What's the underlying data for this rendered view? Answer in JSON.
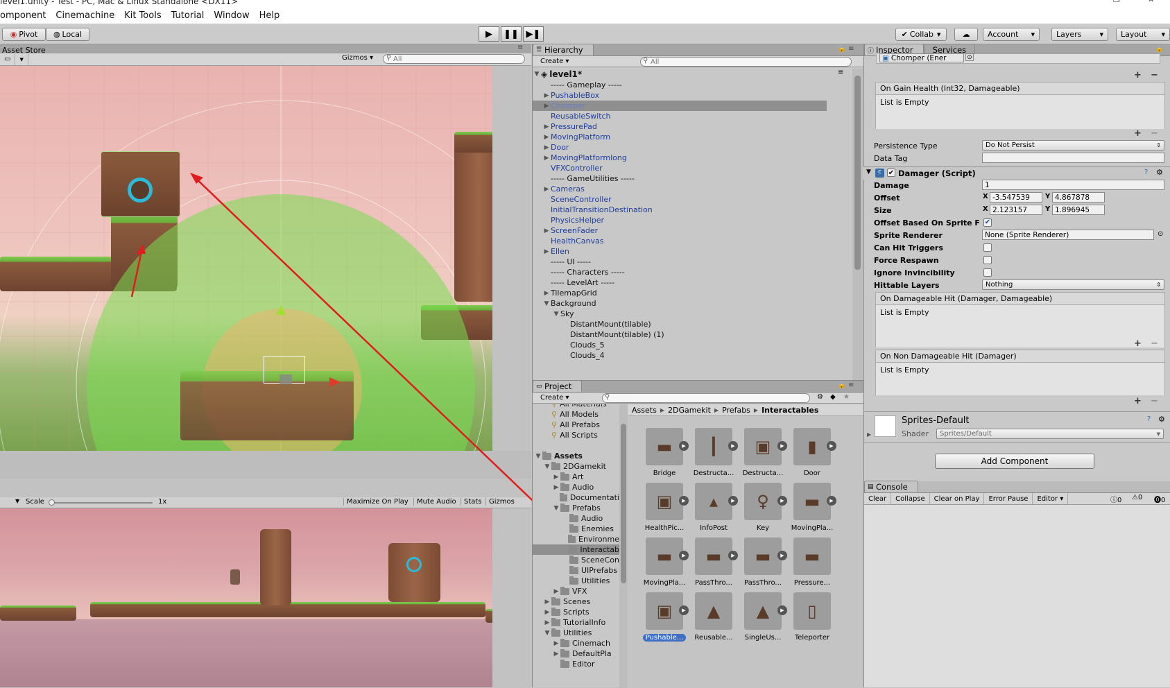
{
  "window_title": "level1.unity - Test - PC, Mac & Linux Standalone <DX11>",
  "window_controls": {
    "minimize": "—",
    "maximize": "❐",
    "close": "✕"
  },
  "menu": [
    "omponent",
    "Cinemachine",
    "Kit Tools",
    "Tutorial",
    "Window",
    "Help"
  ],
  "toolbar": {
    "pivot": "Pivot",
    "local": "Local",
    "collab": "Collab",
    "account": "Account",
    "layers": "Layers",
    "layout": "Layout",
    "play_icon": "play-icon",
    "pause_icon": "pause-icon",
    "step_icon": "step-icon"
  },
  "scene_panel": {
    "tab": "Asset Store",
    "gizmos": "Gizmos",
    "search_placeholder": "All"
  },
  "game_panel": {
    "scale_label": "Scale",
    "scale_value": "1x",
    "buttons": [
      "Maximize On Play",
      "Mute Audio",
      "Stats",
      "Gizmos"
    ]
  },
  "hierarchy": {
    "tab": "Hierarchy",
    "create": "Create",
    "search_placeholder": "All",
    "scene": "level1*",
    "items": [
      {
        "label": "----- Gameplay -----",
        "indent": 1,
        "arrow": "",
        "color": "black"
      },
      {
        "label": "PushableBox",
        "indent": 1,
        "arrow": "▶",
        "color": "blue"
      },
      {
        "label": "Chomper",
        "indent": 1,
        "arrow": "▶",
        "color": "blue",
        "selected": true
      },
      {
        "label": "ReusableSwitch",
        "indent": 1,
        "arrow": "",
        "color": "blue"
      },
      {
        "label": "PressurePad",
        "indent": 1,
        "arrow": "▶",
        "color": "blue"
      },
      {
        "label": "MovingPlatform",
        "indent": 1,
        "arrow": "▶",
        "color": "blue"
      },
      {
        "label": "Door",
        "indent": 1,
        "arrow": "▶",
        "color": "blue"
      },
      {
        "label": "MovingPlatformlong",
        "indent": 1,
        "arrow": "▶",
        "color": "blue"
      },
      {
        "label": "VFXController",
        "indent": 1,
        "arrow": "",
        "color": "blue"
      },
      {
        "label": "----- GameUtilities -----",
        "indent": 1,
        "arrow": "",
        "color": "black"
      },
      {
        "label": "Cameras",
        "indent": 1,
        "arrow": "▶",
        "color": "blue"
      },
      {
        "label": "SceneController",
        "indent": 1,
        "arrow": "",
        "color": "blue"
      },
      {
        "label": "InitialTransitionDestination",
        "indent": 1,
        "arrow": "",
        "color": "blue"
      },
      {
        "label": "PhysicsHelper",
        "indent": 1,
        "arrow": "",
        "color": "blue"
      },
      {
        "label": "ScreenFader",
        "indent": 1,
        "arrow": "▶",
        "color": "blue"
      },
      {
        "label": "HealthCanvas",
        "indent": 1,
        "arrow": "",
        "color": "blue"
      },
      {
        "label": "Ellen",
        "indent": 1,
        "arrow": "▶",
        "color": "blue"
      },
      {
        "label": "----- UI -----",
        "indent": 1,
        "arrow": "",
        "color": "black"
      },
      {
        "label": "----- Characters -----",
        "indent": 1,
        "arrow": "",
        "color": "black"
      },
      {
        "label": "----- LevelArt -----",
        "indent": 1,
        "arrow": "",
        "color": "black"
      },
      {
        "label": "TilemapGrid",
        "indent": 1,
        "arrow": "▶",
        "color": "black"
      },
      {
        "label": "Background",
        "indent": 1,
        "arrow": "▼",
        "color": "black"
      },
      {
        "label": "Sky",
        "indent": 2,
        "arrow": "▼",
        "color": "black"
      },
      {
        "label": "DistantMount(tilable)",
        "indent": 3,
        "arrow": "",
        "color": "black"
      },
      {
        "label": "DistantMount(tilable) (1)",
        "indent": 3,
        "arrow": "",
        "color": "black"
      },
      {
        "label": "Clouds_5",
        "indent": 3,
        "arrow": "",
        "color": "black"
      },
      {
        "label": "Clouds_4",
        "indent": 3,
        "arrow": "",
        "color": "black"
      }
    ]
  },
  "project": {
    "tab": "Project",
    "create": "Create",
    "breadcrumb": [
      "Assets",
      "2DGamekit",
      "Prefabs",
      "Interactables"
    ],
    "tree": [
      {
        "label": "All Materials",
        "indent": 1,
        "arrow": "",
        "search": true
      },
      {
        "label": "All Models",
        "indent": 1,
        "arrow": "",
        "search": true
      },
      {
        "label": "All Prefabs",
        "indent": 1,
        "arrow": "",
        "search": true
      },
      {
        "label": "All Scripts",
        "indent": 1,
        "arrow": "",
        "search": true
      },
      {
        "label": "",
        "indent": 0,
        "arrow": "",
        "spacer": true
      },
      {
        "label": "Assets",
        "indent": 0,
        "arrow": "▼",
        "bold": true
      },
      {
        "label": "2DGamekit",
        "indent": 1,
        "arrow": "▼"
      },
      {
        "label": "Art",
        "indent": 2,
        "arrow": "▶"
      },
      {
        "label": "Audio",
        "indent": 2,
        "arrow": "▶"
      },
      {
        "label": "Documentati",
        "indent": 2,
        "arrow": ""
      },
      {
        "label": "Prefabs",
        "indent": 2,
        "arrow": "▼"
      },
      {
        "label": "Audio",
        "indent": 3,
        "arrow": ""
      },
      {
        "label": "Enemies",
        "indent": 3,
        "arrow": ""
      },
      {
        "label": "Environme",
        "indent": 3,
        "arrow": ""
      },
      {
        "label": "Interactab",
        "indent": 3,
        "arrow": "",
        "selected": true
      },
      {
        "label": "SceneCon",
        "indent": 3,
        "arrow": ""
      },
      {
        "label": "UIPrefabs",
        "indent": 3,
        "arrow": ""
      },
      {
        "label": "Utilities",
        "indent": 3,
        "arrow": ""
      },
      {
        "label": "VFX",
        "indent": 2,
        "arrow": "▶"
      },
      {
        "label": "Scenes",
        "indent": 1,
        "arrow": "▶"
      },
      {
        "label": "Scripts",
        "indent": 1,
        "arrow": "▶"
      },
      {
        "label": "TutorialInfo",
        "indent": 1,
        "arrow": "▶"
      },
      {
        "label": "Utilities",
        "indent": 1,
        "arrow": "▼"
      },
      {
        "label": "Cinemach",
        "indent": 2,
        "arrow": "▶"
      },
      {
        "label": "DefaultPla",
        "indent": 2,
        "arrow": "▶"
      },
      {
        "label": "Editor",
        "indent": 2,
        "arrow": ""
      }
    ],
    "assets": [
      {
        "label": "Bridge",
        "play": true
      },
      {
        "label": "Destructa...",
        "play": true
      },
      {
        "label": "Destructa...",
        "play": true
      },
      {
        "label": "Door",
        "play": true
      },
      {
        "label": "HealthPic...",
        "play": true
      },
      {
        "label": "InfoPost",
        "play": true
      },
      {
        "label": "Key",
        "play": true
      },
      {
        "label": "MovingPla...",
        "play": true
      },
      {
        "label": "MovingPla...",
        "play": true
      },
      {
        "label": "PassThro...",
        "play": true
      },
      {
        "label": "PassThro...",
        "play": true
      },
      {
        "label": "Pressure...",
        "play": false
      },
      {
        "label": "Pushable...",
        "play": true,
        "selected": true
      },
      {
        "label": "Reusable...",
        "play": false
      },
      {
        "label": "SingleUs...",
        "play": true
      },
      {
        "label": "Teleporter",
        "play": false
      }
    ]
  },
  "inspector": {
    "tab": "Inspector",
    "tab2": "Services",
    "object_ref": "Chomper (Ener",
    "event_gain_health": "On Gain Health (Int32, Damageable)",
    "list_empty": "List is Empty",
    "persistence_label": "Persistence Type",
    "persistence_value": "Do Not Persist",
    "data_tag_label": "Data Tag",
    "damager_header": "Damager (Script)",
    "damage_label": "Damage",
    "damage_value": "1",
    "offset_label": "Offset",
    "offset_x": "-3.547539",
    "offset_y": "4.867878",
    "size_label": "Size",
    "size_x": "2.123157",
    "size_y": "1.896945",
    "axis_x": "X",
    "axis_y": "Y",
    "offset_sprite_flip_label": "Offset Based On Sprite F",
    "offset_sprite_flip_checked": true,
    "sprite_renderer_label": "Sprite Renderer",
    "sprite_renderer_value": "None (Sprite Renderer)",
    "can_hit_triggers": "Can Hit Triggers",
    "force_respawn": "Force Respawn",
    "ignore_invincibility": "Ignore Invincibility",
    "hittable_layers_label": "Hittable Layers",
    "hittable_layers_value": "Nothing",
    "event_damageable_hit": "On Damageable Hit (Damager, Damageable)",
    "event_non_damageable_hit": "On Non Damageable Hit (Damager)",
    "material_name": "Sprites-Default",
    "shader_label": "Shader",
    "shader_value": "Sprites/Default",
    "add_component": "Add Component"
  },
  "console": {
    "tab": "Console",
    "buttons": [
      "Clear",
      "Collapse",
      "Clear on Play",
      "Error Pause",
      "Editor"
    ],
    "counts": [
      "0",
      "0",
      "0"
    ]
  },
  "accent": {
    "selection_red": "#e21c1c",
    "hier_blue": "#1d3d9c",
    "selected_row": "#8f8f8f"
  }
}
